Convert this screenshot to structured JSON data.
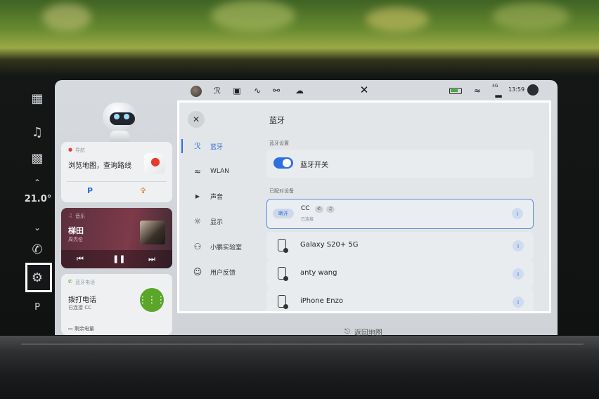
{
  "screen_nav_card": {
    "label": "导航",
    "text": "浏览地图，查询路线",
    "parking_label": "P",
    "food_icon": "fork-knife-icon"
  },
  "music_card": {
    "label": "音乐",
    "title": "梯田",
    "artist": "周杰伦",
    "controls": [
      "previous-icon",
      "pause-icon",
      "next-icon"
    ]
  },
  "phone_card": {
    "label": "蓝牙电话",
    "title": "拨打电话",
    "connected": "已连接 CC",
    "battery": "剩余电量"
  },
  "rail": {
    "temperature": "21.0°",
    "icons": [
      "apps-grid-icon",
      "music-note-icon",
      "car-icon",
      "chevron-up-icon",
      "chevron-down-icon",
      "phone-icon",
      "settings-gear-icon",
      "parking-icon"
    ]
  },
  "statusbar": {
    "time": "13:59",
    "network": "4G"
  },
  "settings": {
    "title": "蓝牙",
    "nav": [
      {
        "label": "蓝牙",
        "icon": "bluetooth-icon"
      },
      {
        "label": "WLAN",
        "icon": "wifi-icon"
      },
      {
        "label": "声音",
        "icon": "speaker-icon"
      },
      {
        "label": "显示",
        "icon": "brightness-icon"
      },
      {
        "label": "小鹏实验室",
        "icon": "lab-icon"
      },
      {
        "label": "用户反馈",
        "icon": "feedback-icon"
      }
    ],
    "bt_settings_label": "蓝牙设置",
    "bt_switch_label": "蓝牙开关",
    "bt_enabled": true,
    "paired_label": "已配对设备",
    "paired_devices": [
      {
        "name": "CC",
        "status": "已连接",
        "tag": "断开"
      },
      {
        "name": "Galaxy S20+ 5G"
      },
      {
        "name": "anty wang"
      },
      {
        "name": "iPhone Enzo"
      }
    ]
  },
  "return_map": "返回地图",
  "colors": {
    "accent": "#2f6fe0",
    "dial_green": "#5aa52a",
    "highlight_border": "#ffffff"
  }
}
